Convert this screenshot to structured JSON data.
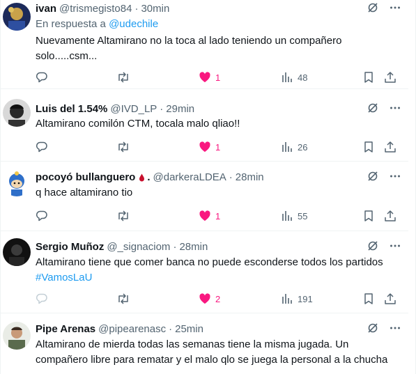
{
  "colors": {
    "accent": "#1d9bf0",
    "like": "#f91880",
    "muted": "#536471",
    "text": "#0f1419"
  },
  "tweets": [
    {
      "name": "ivan",
      "handle": "@trismegisto84",
      "sep": "·",
      "time": "30min",
      "reply_prefix": "En respuesta a",
      "reply_mention": "@udechile",
      "text_lines": [
        "Nuevamente Altamirano no la toca al lado teniendo un compañero",
        "solo.....csm..."
      ],
      "likes": "1",
      "views": "48"
    },
    {
      "name": "Luis del 1.54%",
      "handle": "@IVD_LP",
      "sep": "·",
      "time": "29min",
      "text_lines": [
        "Altamirano comilón CTM, tocala malo qliao!!"
      ],
      "likes": "1",
      "views": "26"
    },
    {
      "name": "pocoyó bullanguero",
      "name_suffix": ".",
      "handle": "@darkeraLDEA",
      "sep": "·",
      "time": "28min",
      "text_lines": [
        "q hace altamirano tio"
      ],
      "likes": "1",
      "views": "55"
    },
    {
      "name": "Sergio Muñoz",
      "handle": "@_signaciom",
      "sep": "·",
      "time": "28min",
      "text_lines": [
        "Altamirano tiene que comer banca no puede esconderse todos los partidos"
      ],
      "hashtag": "#VamosLaU",
      "likes": "2",
      "views": "191"
    },
    {
      "name": "Pipe Arenas",
      "handle": "@pipearenasc",
      "sep": "·",
      "time": "25min",
      "text_lines": [
        "Altamirano de mierda todas las semanas tiene la misma jugada. Un",
        "compañero libre para rematar y el malo qlo se juega la personal a la chucha"
      ]
    }
  ]
}
